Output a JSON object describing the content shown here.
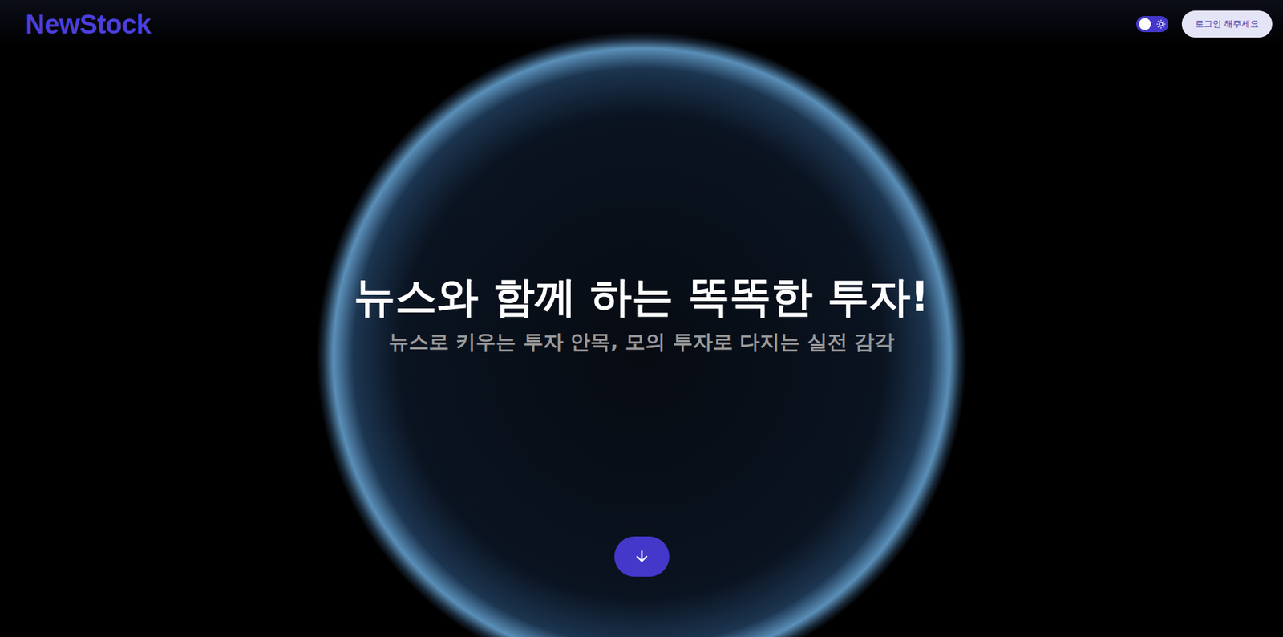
{
  "header": {
    "logo": "NewStock",
    "theme_toggle": {
      "on": false
    },
    "login_button": "로그인 해주세요"
  },
  "hero": {
    "title": "뉴스와 함께 하는 똑똑한 투자!",
    "subtitle": "뉴스로 키우는 투자 안목, 모의 투자로 다지는 실전 감각"
  }
}
